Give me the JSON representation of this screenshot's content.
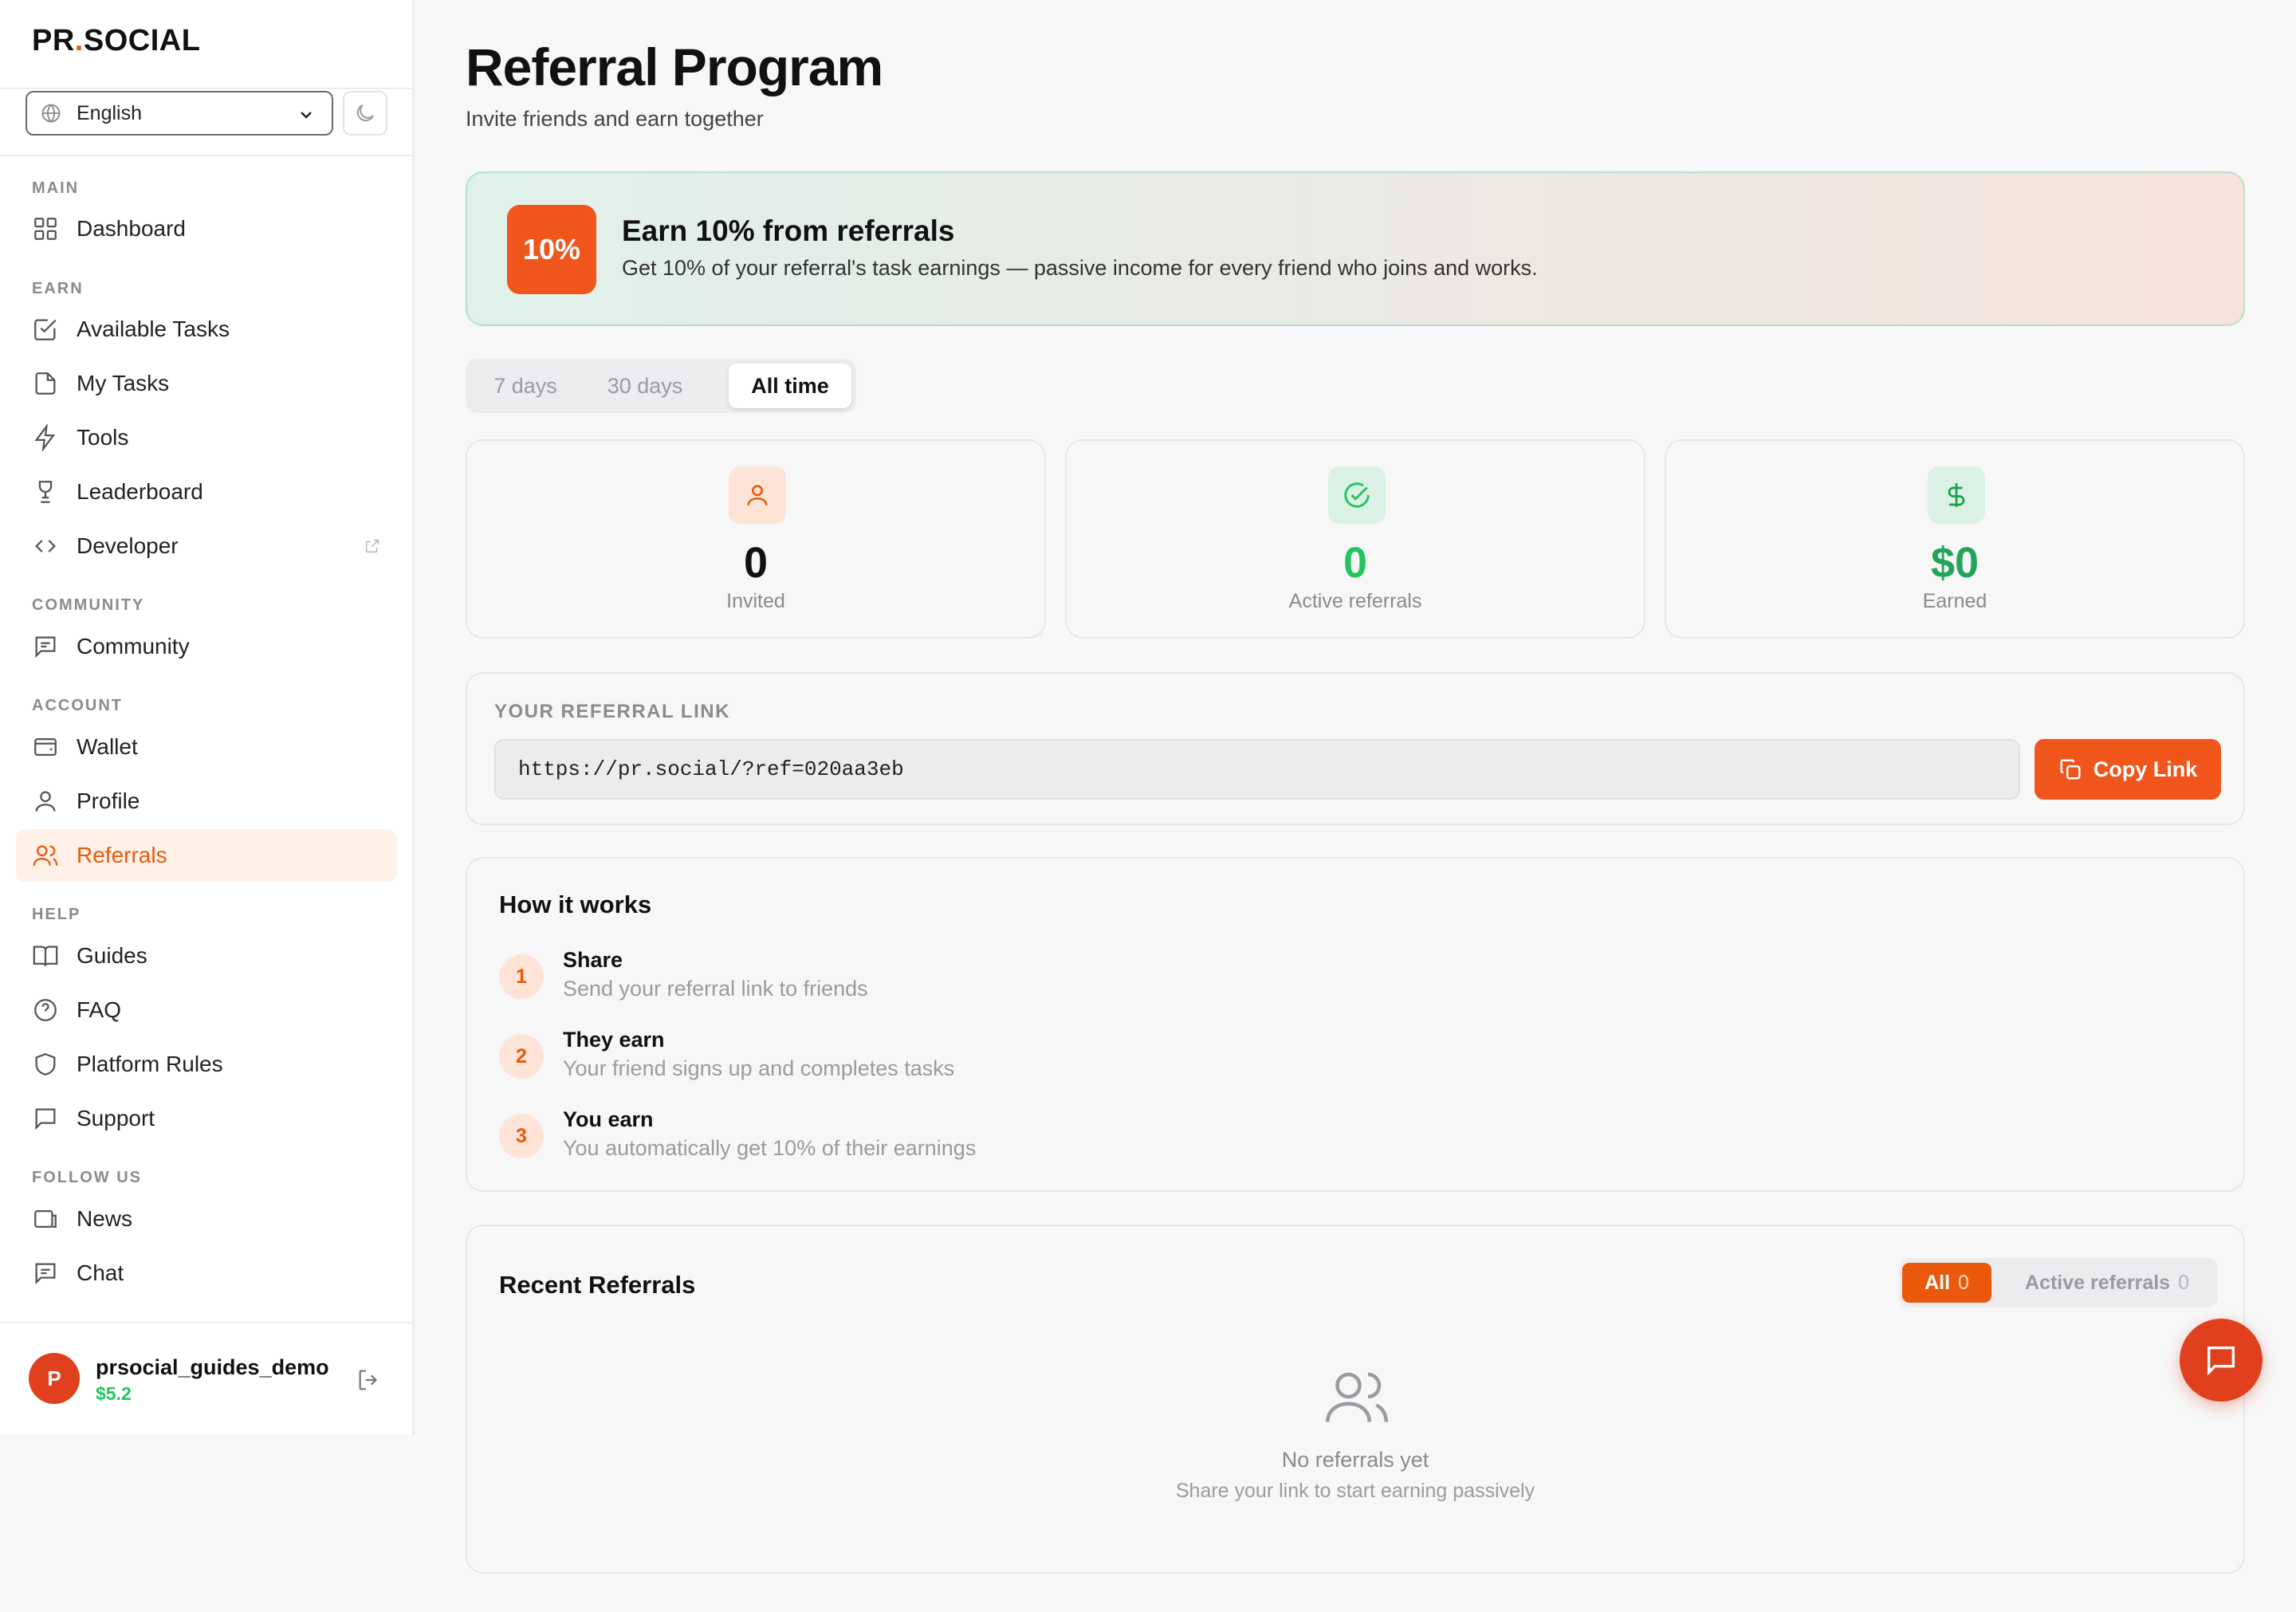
{
  "sidebar": {
    "logo_left": "PR",
    "logo_dot": ".",
    "logo_right": "SOCIAL",
    "language": "English",
    "sections": {
      "main": "MAIN",
      "earn": "EARN",
      "community": "COMMUNITY",
      "account": "ACCOUNT",
      "help": "HELP",
      "follow": "FOLLOW US"
    },
    "items": {
      "dashboard": "Dashboard",
      "available_tasks": "Available Tasks",
      "my_tasks": "My Tasks",
      "tools": "Tools",
      "leaderboard": "Leaderboard",
      "developer": "Developer",
      "community": "Community",
      "wallet": "Wallet",
      "profile": "Profile",
      "referrals": "Referrals",
      "guides": "Guides",
      "faq": "FAQ",
      "platform_rules": "Platform Rules",
      "support": "Support",
      "news": "News",
      "chat": "Chat"
    },
    "user": {
      "initial": "P",
      "name": "prsocial_guides_demo",
      "balance": "$5.2"
    }
  },
  "header": {
    "title": "Referral Program",
    "subtitle": "Invite friends and earn together"
  },
  "banner": {
    "badge": "10%",
    "title": "Earn 10% from referrals",
    "text": "Get 10% of your referral's task earnings — passive income for every friend who joins and works."
  },
  "period_tabs": {
    "t7": "7 days",
    "t30": "30 days",
    "all": "All time",
    "selected": "All time"
  },
  "stats": {
    "invited": {
      "value": "0",
      "label": "Invited"
    },
    "active": {
      "value": "0",
      "label": "Active referrals"
    },
    "earned": {
      "value": "$0",
      "label": "Earned"
    }
  },
  "referral_link": {
    "label": "YOUR REFERRAL LINK",
    "url": "https://pr.social/?ref=020aa3eb",
    "copy_label": "Copy Link"
  },
  "how_it_works": {
    "title": "How it works",
    "steps": [
      {
        "num": "1",
        "title": "Share",
        "desc": "Send your referral link to friends"
      },
      {
        "num": "2",
        "title": "They earn",
        "desc": "Your friend signs up and completes tasks"
      },
      {
        "num": "3",
        "title": "You earn",
        "desc": "You automatically get 10% of their earnings"
      }
    ]
  },
  "recent": {
    "title": "Recent Referrals",
    "filter_all": "All",
    "filter_all_count": "0",
    "filter_active": "Active referrals",
    "filter_active_count": "0",
    "empty_title": "No referrals yet",
    "empty_sub": "Share your link to start earning passively"
  },
  "colors": {
    "accent": "#ea580c",
    "success": "#22c55e",
    "fab": "#e0401e"
  }
}
